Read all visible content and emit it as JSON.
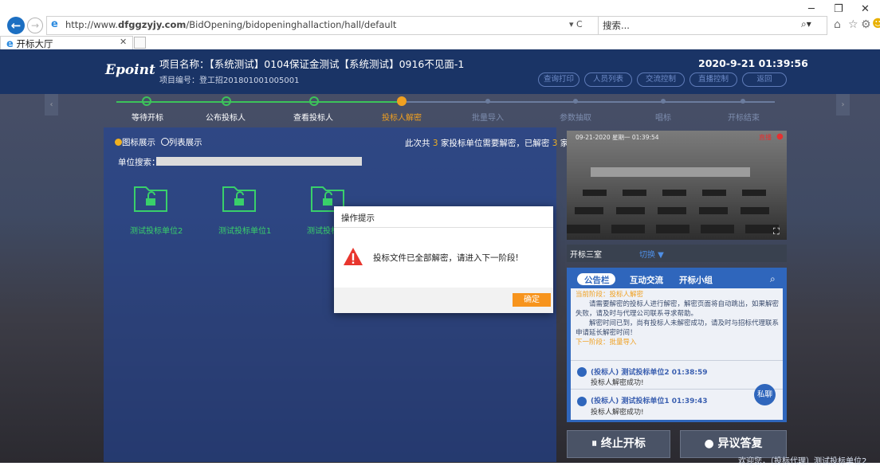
{
  "browser": {
    "url_prefix": "http://www.",
    "url_domain": "dfggzyjy.com",
    "url_path": "/BidOpening/bidopeninghallaction/hall/default",
    "address_controls": "▾ C",
    "search_text": "搜索...",
    "tab_title": "开标大厅"
  },
  "header": {
    "logo": "Epoint",
    "project_name": "项目名称：【系统测试】0104保证金测试【系统测试】0916不见面-1",
    "project_no": "项目编号：登工招201801001005001",
    "datetime": "2020-9-21   01:39:56",
    "buttons": [
      "查询打印",
      "人员列表",
      "交流控制",
      "直播控制",
      "返回"
    ]
  },
  "steps": [
    {
      "label": "等待开标",
      "state": "done"
    },
    {
      "label": "公布投标人",
      "state": "done"
    },
    {
      "label": "查看投标人",
      "state": "done"
    },
    {
      "label": "投标人解密",
      "state": "current"
    },
    {
      "label": "批量导入",
      "state": "pending"
    },
    {
      "label": "参数抽取",
      "state": "pending"
    },
    {
      "label": "唱标",
      "state": "pending"
    },
    {
      "label": "开标结束",
      "state": "pending"
    }
  ],
  "left_panel": {
    "view_icon": "图标展示",
    "view_list": "列表展示",
    "summary_pre": "此次共",
    "summary_count": "3",
    "summary_mid": "家投标单位需要解密，已解密",
    "summary_done": "3",
    "summary_post": "家",
    "unit_search_label": "单位搜索：",
    "bidders": [
      "测试投标单位2",
      "测试投标单位1",
      "测试投标单位3"
    ]
  },
  "video": {
    "timestamp": "09-21-2020 星期一 01:39:54",
    "live_label": "直播",
    "room": "开标三室",
    "switch": "切换 ▼"
  },
  "chat": {
    "tabs": [
      "公告栏",
      "互动交流",
      "开标小组"
    ],
    "notice_stage": "当前阶段：投标人解密",
    "notice_p1": "请需要解密的投标人进行解密，解密页面将自动跳出，如果解密失败，请及时与代理公司联系寻求帮助。",
    "notice_p2": "解密时间已到，尚有投标人未解密成功，请及时与招标代理联系申请延长解密时间！",
    "notice_next": "下一阶段：批量导入",
    "messages": [
      {
        "name": "(投标人) 测试投标单位2 01:38:59",
        "text": "投标人解密成功!"
      },
      {
        "name": "(投标人) 测试投标单位1 01:39:43",
        "text": "投标人解密成功!"
      }
    ],
    "private_chat": "私聊"
  },
  "actions": {
    "stop": "⏸ 终止开标",
    "dispute": "异议答复"
  },
  "welcome": "欢迎您，（投标代理）测试投标单位2",
  "modal": {
    "title": "操作提示",
    "message": "投标文件已全部解密，请进入下一阶段!",
    "ok": "确定"
  },
  "colors": {
    "accent_orange": "#f7941d",
    "step_done": "#3cc35a",
    "header_bg": "#1a3466",
    "chat_blue": "#2f66bc"
  }
}
